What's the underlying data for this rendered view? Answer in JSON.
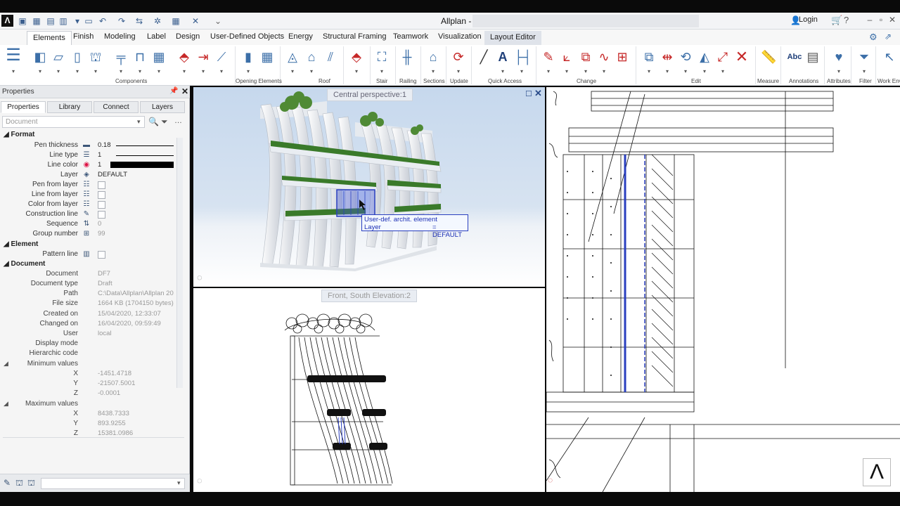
{
  "app": {
    "title": "Allplan -",
    "login": "Login"
  },
  "quick_access_icons": [
    "new-icon",
    "open-icon",
    "save-icon",
    "save-as-icon",
    "comment-icon",
    "undo-icon",
    "redo-icon",
    "convert-icon",
    "settings-icon",
    "layout-icon",
    "tools-icon",
    "more-icon"
  ],
  "menu_tabs": [
    "Elements",
    "Finish",
    "Modeling",
    "Label",
    "Design",
    "User-Defined Objects",
    "Energy",
    "Structural Framing",
    "Teamwork",
    "Visualization",
    "Layout Editor"
  ],
  "ribbon_groups": [
    "Components",
    "Opening Elements",
    "Roof",
    "Stair",
    "Railing",
    "Sections",
    "Update",
    "Quick Access",
    "Change",
    "Edit",
    "Measure",
    "Annotations",
    "Attributes",
    "Filter",
    "Work Env"
  ],
  "properties": {
    "panel_title": "Properties",
    "tabs": [
      "Properties",
      "Library",
      "Connect",
      "Layers"
    ],
    "selector_placeholder": "Document",
    "sections": {
      "format": "Format",
      "element": "Element",
      "document": "Document"
    },
    "format": [
      {
        "label": "Pen thickness",
        "value": "0.18"
      },
      {
        "label": "Line type",
        "value": "1"
      },
      {
        "label": "Line color",
        "value": "1"
      },
      {
        "label": "Layer",
        "value": "DEFAULT"
      },
      {
        "label": "Pen from layer"
      },
      {
        "label": "Line from layer"
      },
      {
        "label": "Color from layer"
      },
      {
        "label": "Construction line"
      },
      {
        "label": "Sequence",
        "value": "0"
      },
      {
        "label": "Group number",
        "value": "99"
      }
    ],
    "element": [
      {
        "label": "Pattern line"
      }
    ],
    "document": [
      {
        "label": "Document",
        "value": "DF7"
      },
      {
        "label": "Document type",
        "value": "Draft"
      },
      {
        "label": "Path",
        "value": "C:\\Data\\Allplan\\Allplan 20"
      },
      {
        "label": "File size",
        "value": "1664 KB (1704150 bytes)"
      },
      {
        "label": "Created on",
        "value": "15/04/2020, 12:33:07"
      },
      {
        "label": "Changed on",
        "value": "16/04/2020, 09:59:49"
      },
      {
        "label": "User",
        "value": "local"
      },
      {
        "label": "Display mode",
        "value": ""
      },
      {
        "label": "Hierarchic code",
        "value": ""
      }
    ],
    "minimum_values": {
      "label": "Minimum values",
      "x": "-1451.4718",
      "y": "-21507.5001",
      "z": "-0.0001"
    },
    "maximum_values": {
      "label": "Maximum values",
      "x": "8438.7333",
      "y": "893.9255",
      "z": "15381.0986"
    }
  },
  "viewports": {
    "perspective_label": "Central perspective:1",
    "elevation_label": "Front, South Elevation:2"
  },
  "tooltip": {
    "line1": "User-def. archit. element",
    "line2_key": "Layer",
    "line2_value": "= DEFAULT"
  },
  "colors": {
    "accent": "#3c6fa8",
    "selection": "#2a3fbf",
    "line_color_swatch": "#000000"
  }
}
